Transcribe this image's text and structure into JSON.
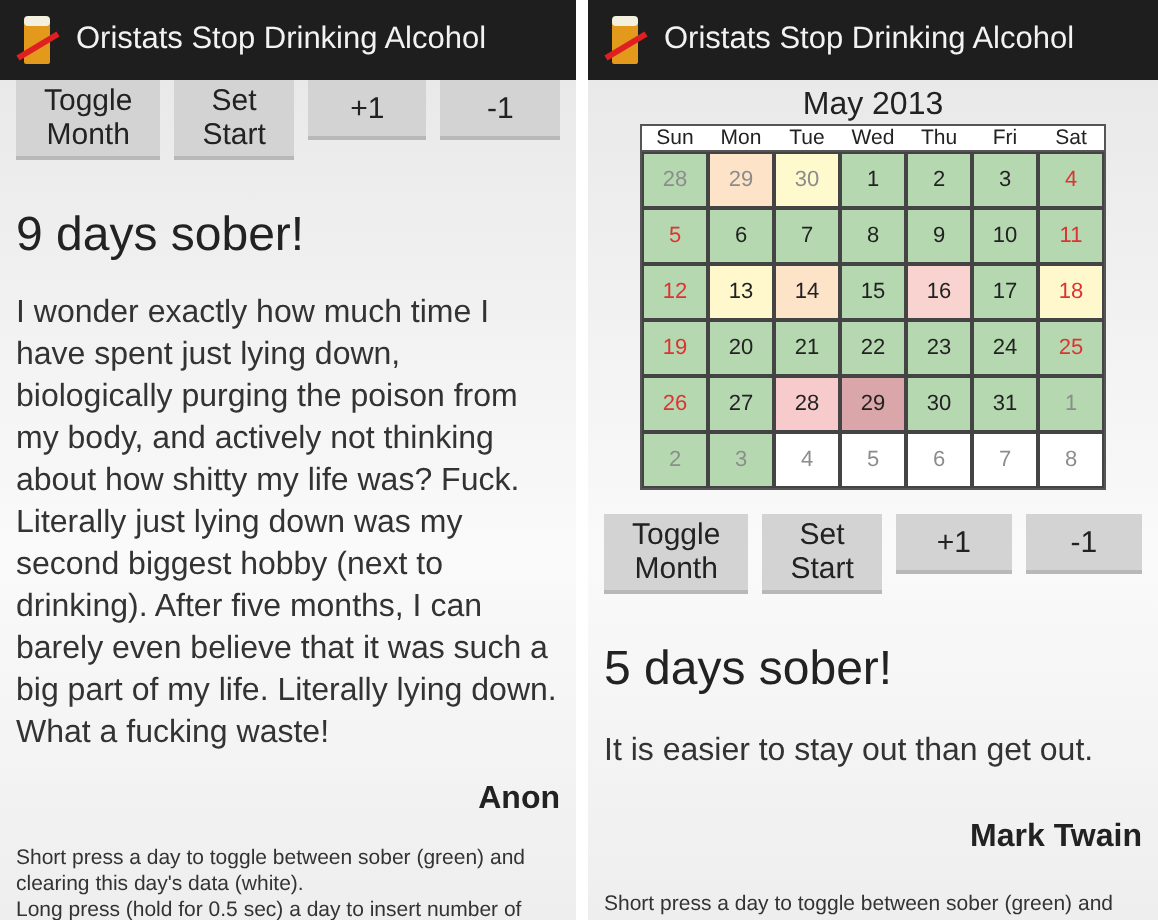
{
  "screens": [
    {
      "title": "Oristats Stop Drinking Alcohol",
      "buttons": [
        "Toggle Month",
        "Set Start",
        "+1",
        "-1"
      ],
      "days_sober": "9 days sober!",
      "quote": "I wonder exactly how much time I have spent just lying down, biologically purging the poison from my body, and actively not thinking about how shitty my life was? Fuck. Literally just lying down was my second biggest hobby (next to drinking). After five months, I can barely even believe that it was such a big part of my life. Literally lying down. What a fucking waste!",
      "author": "Anon",
      "help": [
        "Short press a day to toggle between sober (green) and clearing this day's data (white).",
        "Long press (hold for 0.5 sec) a day to insert number of"
      ]
    },
    {
      "title": "Oristats Stop Drinking Alcohol",
      "calendar": {
        "month": "May 2013",
        "weekdays": [
          "Sun",
          "Mon",
          "Tue",
          "Wed",
          "Thu",
          "Fri",
          "Sat"
        ],
        "weeks": [
          [
            {
              "label": "28",
              "kind": "outside",
              "color": "#b5d8b0"
            },
            {
              "label": "29",
              "kind": "outside",
              "color": "#fde3c8"
            },
            {
              "label": "30",
              "kind": "outside",
              "color": "#fffacd"
            },
            {
              "label": "1",
              "kind": "weekday",
              "color": "#b5d8b0"
            },
            {
              "label": "2",
              "kind": "weekday",
              "color": "#b5d8b0"
            },
            {
              "label": "3",
              "kind": "weekday",
              "color": "#b5d8b0"
            },
            {
              "label": "4",
              "kind": "weekend",
              "color": "#b5d8b0"
            }
          ],
          [
            {
              "label": "5",
              "kind": "weekend",
              "color": "#b5d8b0"
            },
            {
              "label": "6",
              "kind": "weekday",
              "color": "#b5d8b0"
            },
            {
              "label": "7",
              "kind": "weekday",
              "color": "#b5d8b0"
            },
            {
              "label": "8",
              "kind": "weekday",
              "color": "#b5d8b0"
            },
            {
              "label": "9",
              "kind": "weekday",
              "color": "#b5d8b0"
            },
            {
              "label": "10",
              "kind": "weekday",
              "color": "#b5d8b0"
            },
            {
              "label": "11",
              "kind": "weekend",
              "color": "#b5d8b0"
            }
          ],
          [
            {
              "label": "12",
              "kind": "weekend",
              "color": "#b5d8b0"
            },
            {
              "label": "13",
              "kind": "weekday",
              "color": "#fff8cc"
            },
            {
              "label": "14",
              "kind": "weekday",
              "color": "#fde3c8"
            },
            {
              "label": "15",
              "kind": "weekday",
              "color": "#b5d8b0"
            },
            {
              "label": "16",
              "kind": "weekday",
              "color": "#f8d3cf"
            },
            {
              "label": "17",
              "kind": "weekday",
              "color": "#b5d8b0"
            },
            {
              "label": "18",
              "kind": "weekend",
              "color": "#fff8cc"
            }
          ],
          [
            {
              "label": "19",
              "kind": "weekend",
              "color": "#b5d8b0"
            },
            {
              "label": "20",
              "kind": "weekday",
              "color": "#b5d8b0"
            },
            {
              "label": "21",
              "kind": "weekday",
              "color": "#b5d8b0"
            },
            {
              "label": "22",
              "kind": "weekday",
              "color": "#b5d8b0"
            },
            {
              "label": "23",
              "kind": "weekday",
              "color": "#b5d8b0"
            },
            {
              "label": "24",
              "kind": "weekday",
              "color": "#b5d8b0"
            },
            {
              "label": "25",
              "kind": "weekend",
              "color": "#b5d8b0"
            }
          ],
          [
            {
              "label": "26",
              "kind": "weekend",
              "color": "#b5d8b0"
            },
            {
              "label": "27",
              "kind": "weekday",
              "color": "#b5d8b0"
            },
            {
              "label": "28",
              "kind": "weekday",
              "color": "#f7cacc"
            },
            {
              "label": "29",
              "kind": "weekday",
              "color": "#dba6a9"
            },
            {
              "label": "30",
              "kind": "weekday",
              "color": "#b5d8b0"
            },
            {
              "label": "31",
              "kind": "weekday",
              "color": "#b5d8b0"
            },
            {
              "label": "1",
              "kind": "outside",
              "color": "#b5d8b0"
            }
          ],
          [
            {
              "label": "2",
              "kind": "outside",
              "color": "#b5d8b0"
            },
            {
              "label": "3",
              "kind": "outside",
              "color": "#b5d8b0"
            },
            {
              "label": "4",
              "kind": "outside",
              "color": "#ffffff"
            },
            {
              "label": "5",
              "kind": "outside",
              "color": "#ffffff"
            },
            {
              "label": "6",
              "kind": "outside",
              "color": "#ffffff"
            },
            {
              "label": "7",
              "kind": "outside",
              "color": "#ffffff"
            },
            {
              "label": "8",
              "kind": "outside",
              "color": "#ffffff"
            }
          ]
        ]
      },
      "buttons": [
        "Toggle Month",
        "Set Start",
        "+1",
        "-1"
      ],
      "days_sober": "5 days sober!",
      "quote": "It is easier to stay out than get out.",
      "author": "Mark Twain",
      "help": [
        "Short press a day to toggle between sober (green) and"
      ]
    }
  ]
}
